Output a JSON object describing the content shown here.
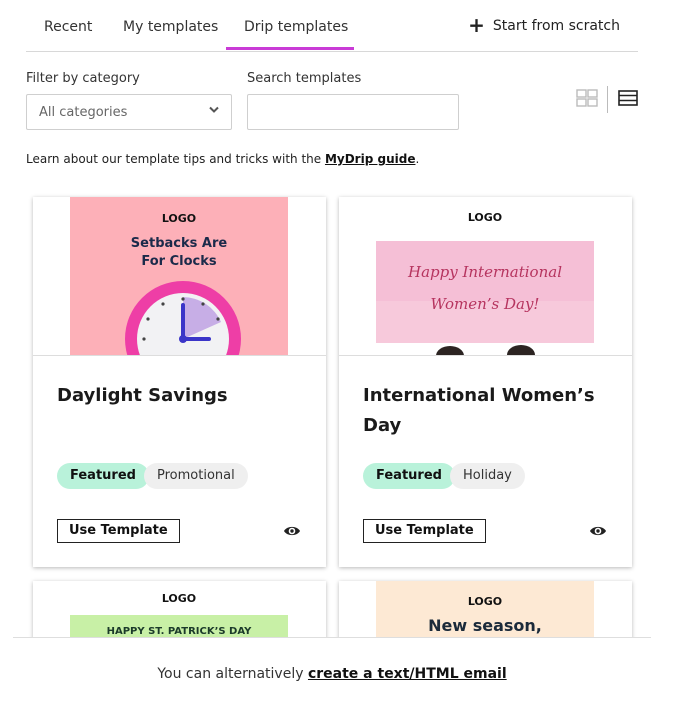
{
  "tabs": [
    {
      "label": "Recent"
    },
    {
      "label": "My templates"
    },
    {
      "label": "Drip templates",
      "active": true
    }
  ],
  "start_from_scratch": "Start from scratch",
  "filters": {
    "category_label": "Filter by category",
    "category_value": "All categories",
    "search_label": "Search templates",
    "search_value": ""
  },
  "info": {
    "prefix": "Learn about our template tips and tricks with the ",
    "link": "MyDrip guide",
    "suffix": "."
  },
  "cards": [
    {
      "title": "Daylight Savings",
      "tags": [
        "Featured",
        "Promotional"
      ],
      "thumb": {
        "logo": "LOGO",
        "heading_line1": "Setbacks Are",
        "heading_line2": "For Clocks"
      },
      "use_label": "Use Template"
    },
    {
      "title": "International Women’s Day",
      "tags": [
        "Featured",
        "Holiday"
      ],
      "thumb": {
        "logo": "LOGO",
        "script_line1": "Happy International",
        "script_line2": "Women’s Day!"
      },
      "use_label": "Use Template"
    },
    {
      "thumb": {
        "logo": "LOGO",
        "banner": "HAPPY ST. PATRICK’S DAY"
      }
    },
    {
      "thumb": {
        "logo": "LOGO",
        "heading": "New season,"
      }
    }
  ],
  "bottom": {
    "prefix": "You can alternatively ",
    "link": "create a text/HTML email"
  },
  "colors": {
    "accent": "#c93bd6",
    "featured_bg": "#b9f2da",
    "tag_bg": "#efefef",
    "pink_thumb": "#fdb0b8",
    "green_banner": "#c8f0a6",
    "peach_thumb": "#fde9d4"
  }
}
